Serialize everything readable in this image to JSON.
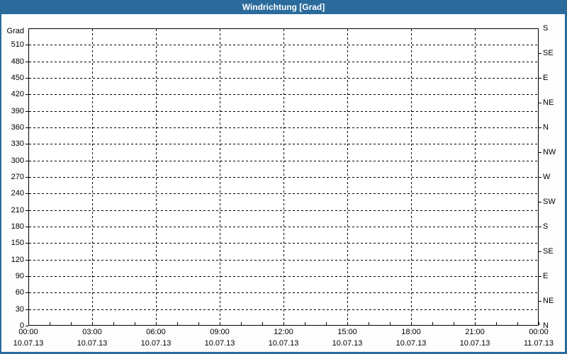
{
  "window": {
    "title": "Windrichtung [Grad]"
  },
  "colors": {
    "titlebar_bg": "#2A6B9C",
    "titlebar_text": "#FFFFFF",
    "frame_border": "#2A6B9C",
    "canvas_bg": "#FDFDFD",
    "plot_bg": "#FFFFFF",
    "grid_line": "#000000",
    "axis_text": "#000000"
  },
  "chart_data": {
    "type": "line",
    "title": "Windrichtung [Grad]",
    "series": [],
    "grid": true,
    "legend": null,
    "y_axis_left": {
      "unit_label": "Grad",
      "min": 0,
      "max": 540,
      "step": 30,
      "tick_labels": [
        "510",
        "480",
        "450",
        "420",
        "390",
        "360",
        "330",
        "300",
        "270",
        "240",
        "210",
        "180",
        "150",
        "120",
        "90",
        "60",
        "30",
        "0"
      ]
    },
    "y_axis_right": {
      "step_deg": 45,
      "tick_labels_top_to_bottom": [
        "S",
        "SE",
        "E",
        "NE",
        "N",
        "NW",
        "W",
        "SW",
        "S",
        "SE",
        "E",
        "NE",
        "N"
      ]
    },
    "x_axis": {
      "min_hour": 0,
      "max_hour": 24,
      "minor_tick_every_hours": 1,
      "gridline_hours": [
        3,
        6,
        9,
        12,
        15,
        18,
        21
      ],
      "ticks": [
        {
          "hour": 0,
          "time": "00:00",
          "date": "10.07.13"
        },
        {
          "hour": 3,
          "time": "03:00",
          "date": "10.07.13"
        },
        {
          "hour": 6,
          "time": "06:00",
          "date": "10.07.13"
        },
        {
          "hour": 9,
          "time": "09:00",
          "date": "10.07.13"
        },
        {
          "hour": 12,
          "time": "12:00",
          "date": "10.07.13"
        },
        {
          "hour": 15,
          "time": "15:00",
          "date": "10.07.13"
        },
        {
          "hour": 18,
          "time": "18:00",
          "date": "10.07.13"
        },
        {
          "hour": 21,
          "time": "21:00",
          "date": "10.07.13"
        },
        {
          "hour": 24,
          "time": "00:00",
          "date": "11.07.13"
        }
      ]
    }
  }
}
